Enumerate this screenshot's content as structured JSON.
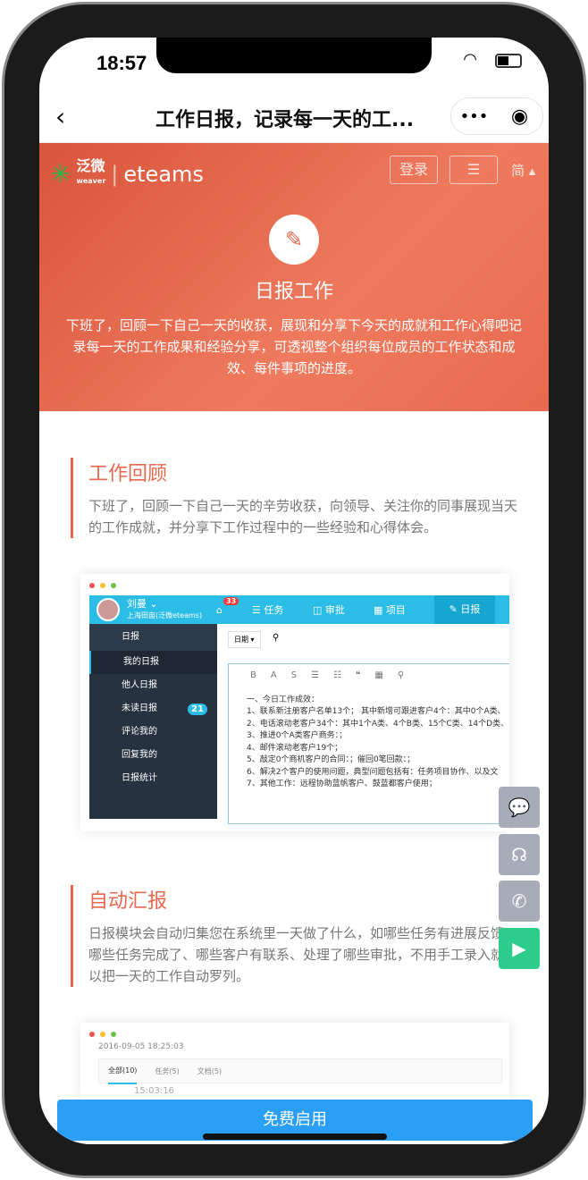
{
  "status": {
    "time": "18:57"
  },
  "nav": {
    "back_icon": "chevron-left",
    "title": "工作日报，记录每一天的工...",
    "more": "•••",
    "target": "◉"
  },
  "hero": {
    "logo_cn": "泛微",
    "logo_en": "weaver",
    "brand": "eteams",
    "login": "登录",
    "menu": "☰",
    "lang": "简 ▴",
    "title": "日报工作",
    "desc": "下班了，回顾一下自己一天的收获，展现和分享下今天的成就和工作心得吧记录每一天的工作成果和经验分享，可透视整个组织每位成员的工作状态和成效、每件事项的进度。",
    "accent": "#e8684f"
  },
  "sections": [
    {
      "title": "工作回顾",
      "desc": "下班了，回顾一下自己一天的辛劳收获，向领导、关注你的同事展现当天的工作成就，并分享下工作过程中的一些经验和心得体会。"
    },
    {
      "title": "自动汇报",
      "desc": "日报模块会自动归集您在系统里一天做了什么，如哪些任务有进展反馈、哪些任务完成了、哪些客户有联系、处理了哪些审批，不用手工录入就可以把一天的工作自动罗列。"
    }
  ],
  "shot1": {
    "user": "刘曼 ⌄",
    "company": "上海田亩(泛微eteams)",
    "badge": "33",
    "tabs": [
      "☰ 任务",
      "◫ 审批",
      "▦ 项目",
      "✎ 日报"
    ],
    "side_header": "日报",
    "side": [
      "我的日报",
      "他人日报",
      "未读日报",
      "评论我的",
      "回复我的",
      "日报统计"
    ],
    "unread": "21",
    "filter": "日期 ▾",
    "toolbar": [
      "B",
      "A",
      "S",
      "☰",
      "☷",
      "❝",
      "▦",
      "⚲"
    ],
    "lines": [
      "一、今日工作成效：",
      "1、联系新注册客户名单13个； 其中新增可跟进客户4个：其中0个A类、",
      "2、电话滚动老客户34个：其中1个A类、4个B类、15个C类、14个D类、",
      "3、推进0个A类客户商务：；",
      "4、邮件滚动老客户19个；",
      "5、敲定0个商机客户的合同：；催回0笔回款：；",
      "6、解决2个客户的使用问题，典型问题包括有：任务项目协作、以及文",
      "7、其他工作：远程协助蓝帆客户、鼓蓝都客户使用；"
    ]
  },
  "shot2": {
    "date": "2016-09-05 18:25:03",
    "tabs": [
      "全部(10)",
      "任务(5)",
      "文档(5)"
    ],
    "time": "15:03:16"
  },
  "fabs": [
    {
      "icon": "chat-bubble",
      "glyph": "💬"
    },
    {
      "icon": "headset",
      "glyph": "☊"
    },
    {
      "icon": "wechat",
      "glyph": "✆"
    },
    {
      "icon": "tv",
      "glyph": "▶"
    }
  ],
  "fab_green": "#2ecc8a",
  "cta": "免费启用"
}
